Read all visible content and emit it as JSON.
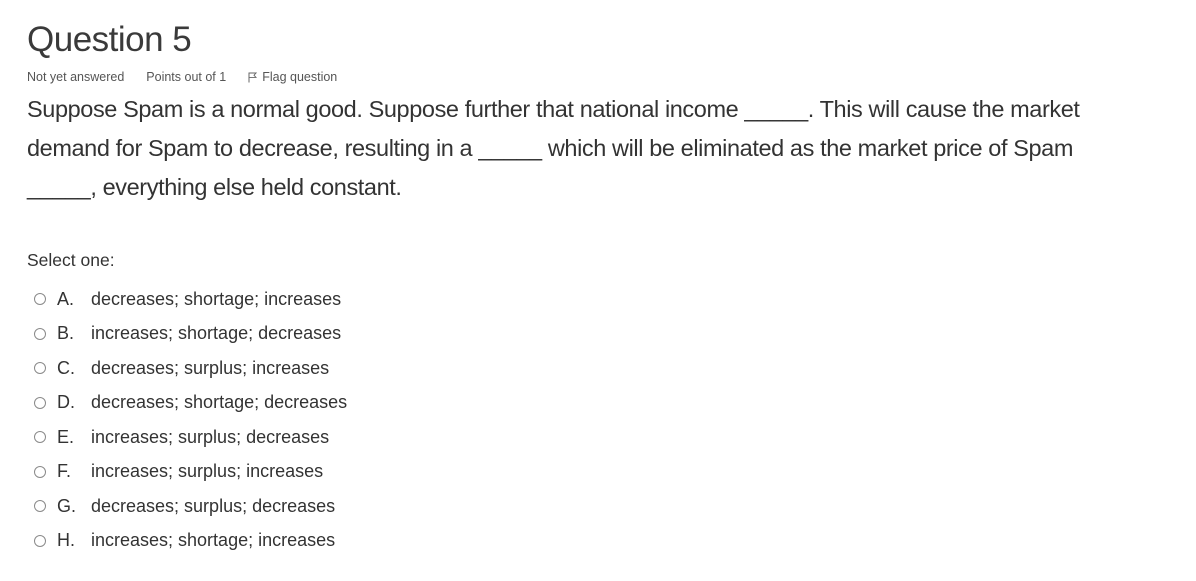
{
  "question": {
    "title": "Question 5",
    "state": "Not yet answered",
    "grade": "Points out of 1",
    "flag_label": "Flag question",
    "text": "Suppose Spam is a normal good. Suppose further that national income _____.  This will cause the market demand for Spam to decrease, resulting in a _____ which will be eliminated as the market price of Spam _____, everything else held constant.",
    "prompt": "Select one:",
    "options": [
      {
        "letter": "A.",
        "text": "decreases; shortage; increases"
      },
      {
        "letter": "B.",
        "text": "increases; shortage; decreases"
      },
      {
        "letter": "C.",
        "text": "decreases; surplus; increases"
      },
      {
        "letter": "D.",
        "text": "decreases; shortage; decreases"
      },
      {
        "letter": "E.",
        "text": "increases; surplus; decreases"
      },
      {
        "letter": "F.",
        "text": "increases; surplus; increases"
      },
      {
        "letter": "G.",
        "text": "decreases; surplus; decreases"
      },
      {
        "letter": "H.",
        "text": "increases; shortage; increases"
      }
    ]
  }
}
